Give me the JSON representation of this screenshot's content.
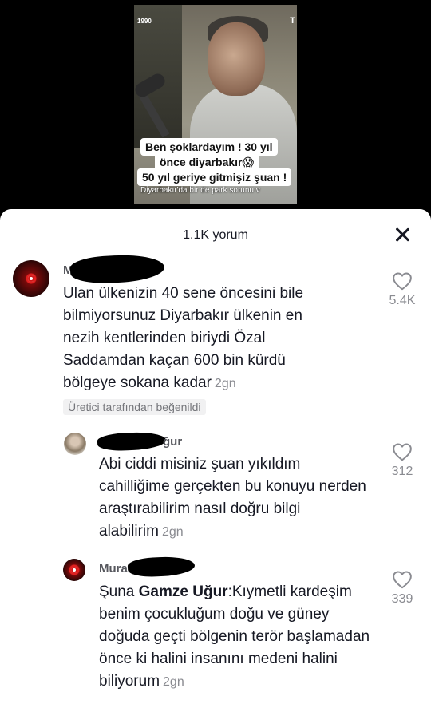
{
  "video": {
    "year_label": "1990",
    "corner_letter": "T",
    "caption_line1": "Ben şoklardayım ! 30 yıl",
    "caption_line2": "önce diyarbakır😱",
    "caption_line3": "50 yıl geriye gitmişiz şuan !",
    "subtitle": "Diyarbakır'da bir de park sorunu v"
  },
  "sheet": {
    "title": "1.1K yorum",
    "close_icon": "close-icon"
  },
  "comments": [
    {
      "username_visible": "Mu",
      "avatar": "red-flag-avatar",
      "text": "Ulan ülkenizin 40 sene öncesini bile bilmiyorsunuz Diyarbakır ülkenin en nezih kentlerinden biriydi Özal Saddamdan kaçan 600 bin kürdü bölgeye sokana kadar",
      "date": "2gn",
      "badge": "Üretici tarafından beğenildi",
      "likes": "5.4K"
    },
    {
      "username_visible": "ğur",
      "avatar": "photo-avatar",
      "text": "Abi ciddi misiniz şuan yıkıldım cahilliğime gerçekten bu konuyu nerden araştırabilirim nasıl doğru bilgi alabilirim",
      "date": "2gn",
      "likes": "312"
    },
    {
      "username_visible": "Mura",
      "avatar": "red-flag-avatar",
      "text_prefix": "Şuna ",
      "mention": "Gamze Uğur",
      "text_suffix": ":Kıymetli kardeşim benim çocukluğum doğu ve güney doğuda geçti bölgenin terör başlamadan önce ki halini insanını medeni halini biliyorum",
      "date": "2gn",
      "likes": "339"
    }
  ]
}
